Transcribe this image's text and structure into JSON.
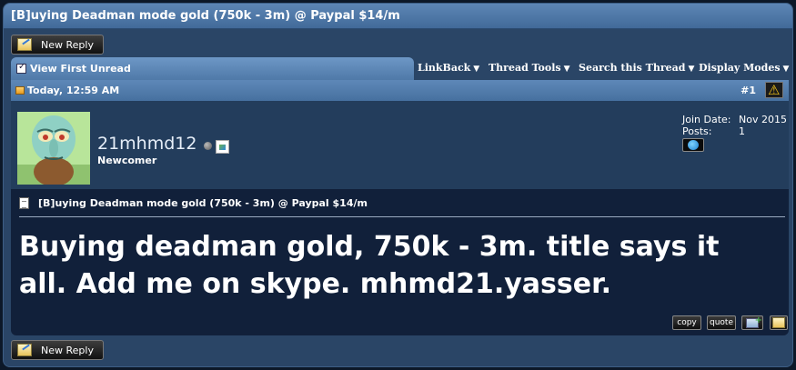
{
  "thread": {
    "title": "[B]uying Deadman mode gold (750k - 3m) @ Paypal $14/m"
  },
  "toolbar": {
    "new_reply_label": "New Reply"
  },
  "tabs": {
    "view_first_unread": "View First Unread",
    "menus": [
      {
        "label": "LinkBack"
      },
      {
        "label": "Thread Tools"
      },
      {
        "label": "Search this Thread"
      },
      {
        "label": "Display Modes"
      }
    ]
  },
  "post": {
    "date": "Today, 12:59 AM",
    "number": "#1",
    "user": {
      "name": "21mhmd12",
      "title": "Newcomer",
      "join_date_label": "Join Date:",
      "join_date": "Nov 2015",
      "posts_label": "Posts:",
      "posts": "1"
    },
    "title": "[B]uying Deadman mode gold (750k - 3m) @ Paypal $14/m",
    "message": "Buying deadman gold, 750k - 3m. title says it all. Add me on skype. mhmd21.yasser.",
    "actions": {
      "copy": "copy",
      "quote": "quote"
    }
  },
  "colors": {
    "title_bar": "#4f78a8",
    "body_bg": "#11203a",
    "frame": "#2a4566"
  }
}
